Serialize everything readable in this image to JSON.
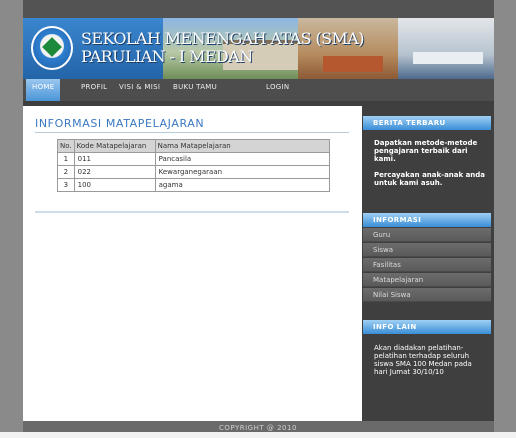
{
  "header": {
    "school_name_line1": "SEKOLAH MENENGAH ATAS (SMA)",
    "school_name_line2": "PARULIAN - I MEDAN"
  },
  "nav": {
    "items": [
      {
        "label": "HOME",
        "active": true
      },
      {
        "label": "PROFIL",
        "active": false
      },
      {
        "label": "VISI & MISI",
        "active": false
      },
      {
        "label": "BUKU TAMU",
        "active": false
      },
      {
        "label": "LOGIN",
        "active": false
      }
    ]
  },
  "main": {
    "title": "INFORMASI MATAPELAJARAN",
    "table": {
      "headers": [
        "No.",
        "Kode Matapelajaran",
        "Nama Matapelajaran"
      ],
      "rows": [
        [
          "1",
          "011",
          "Pancasila"
        ],
        [
          "2",
          "022",
          "Kewarganegaraan"
        ],
        [
          "3",
          "100",
          "agama"
        ]
      ]
    }
  },
  "sidebar": {
    "berita": {
      "title": "BERITA TERBARU",
      "text1": "Dapatkan metode-metode pengajaran terbaik dari kami.",
      "text2": "Percayakan anak-anak anda untuk kami asuh."
    },
    "informasi": {
      "title": "INFORMASI",
      "links": [
        "Guru",
        "Siswa",
        "Fasilitas",
        "Matapelajaran",
        "Nilai Siswa"
      ]
    },
    "info_lain": {
      "title": "INFO LAIN",
      "text": "Akan diadakan pelatihan-pelatihan terhadap seluruh siswa SMA 100 Medan pada hari Jumat 30/10/10"
    }
  },
  "footer": {
    "copyright": "COPYRIGHT @ 2010"
  },
  "colors": {
    "accent": "#3b78c3",
    "sidebar_bg": "#3f3f3f",
    "nav_active": "#4b95d8"
  }
}
